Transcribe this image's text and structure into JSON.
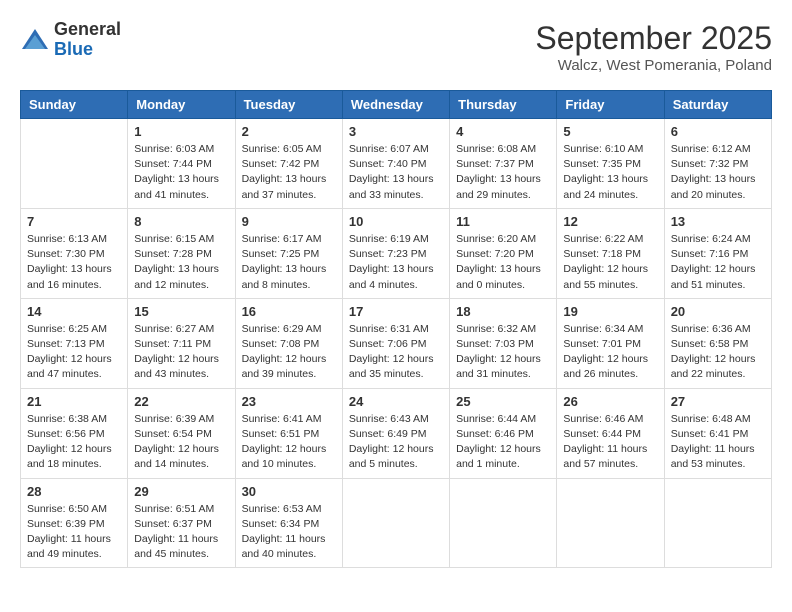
{
  "header": {
    "logo": {
      "general": "General",
      "blue": "Blue"
    },
    "title": "September 2025",
    "location": "Walcz, West Pomerania, Poland"
  },
  "weekdays": [
    "Sunday",
    "Monday",
    "Tuesday",
    "Wednesday",
    "Thursday",
    "Friday",
    "Saturday"
  ],
  "weeks": [
    [
      {
        "day": "",
        "sunrise": "",
        "sunset": "",
        "daylight": ""
      },
      {
        "day": "1",
        "sunrise": "Sunrise: 6:03 AM",
        "sunset": "Sunset: 7:44 PM",
        "daylight": "Daylight: 13 hours and 41 minutes."
      },
      {
        "day": "2",
        "sunrise": "Sunrise: 6:05 AM",
        "sunset": "Sunset: 7:42 PM",
        "daylight": "Daylight: 13 hours and 37 minutes."
      },
      {
        "day": "3",
        "sunrise": "Sunrise: 6:07 AM",
        "sunset": "Sunset: 7:40 PM",
        "daylight": "Daylight: 13 hours and 33 minutes."
      },
      {
        "day": "4",
        "sunrise": "Sunrise: 6:08 AM",
        "sunset": "Sunset: 7:37 PM",
        "daylight": "Daylight: 13 hours and 29 minutes."
      },
      {
        "day": "5",
        "sunrise": "Sunrise: 6:10 AM",
        "sunset": "Sunset: 7:35 PM",
        "daylight": "Daylight: 13 hours and 24 minutes."
      },
      {
        "day": "6",
        "sunrise": "Sunrise: 6:12 AM",
        "sunset": "Sunset: 7:32 PM",
        "daylight": "Daylight: 13 hours and 20 minutes."
      }
    ],
    [
      {
        "day": "7",
        "sunrise": "Sunrise: 6:13 AM",
        "sunset": "Sunset: 7:30 PM",
        "daylight": "Daylight: 13 hours and 16 minutes."
      },
      {
        "day": "8",
        "sunrise": "Sunrise: 6:15 AM",
        "sunset": "Sunset: 7:28 PM",
        "daylight": "Daylight: 13 hours and 12 minutes."
      },
      {
        "day": "9",
        "sunrise": "Sunrise: 6:17 AM",
        "sunset": "Sunset: 7:25 PM",
        "daylight": "Daylight: 13 hours and 8 minutes."
      },
      {
        "day": "10",
        "sunrise": "Sunrise: 6:19 AM",
        "sunset": "Sunset: 7:23 PM",
        "daylight": "Daylight: 13 hours and 4 minutes."
      },
      {
        "day": "11",
        "sunrise": "Sunrise: 6:20 AM",
        "sunset": "Sunset: 7:20 PM",
        "daylight": "Daylight: 13 hours and 0 minutes."
      },
      {
        "day": "12",
        "sunrise": "Sunrise: 6:22 AM",
        "sunset": "Sunset: 7:18 PM",
        "daylight": "Daylight: 12 hours and 55 minutes."
      },
      {
        "day": "13",
        "sunrise": "Sunrise: 6:24 AM",
        "sunset": "Sunset: 7:16 PM",
        "daylight": "Daylight: 12 hours and 51 minutes."
      }
    ],
    [
      {
        "day": "14",
        "sunrise": "Sunrise: 6:25 AM",
        "sunset": "Sunset: 7:13 PM",
        "daylight": "Daylight: 12 hours and 47 minutes."
      },
      {
        "day": "15",
        "sunrise": "Sunrise: 6:27 AM",
        "sunset": "Sunset: 7:11 PM",
        "daylight": "Daylight: 12 hours and 43 minutes."
      },
      {
        "day": "16",
        "sunrise": "Sunrise: 6:29 AM",
        "sunset": "Sunset: 7:08 PM",
        "daylight": "Daylight: 12 hours and 39 minutes."
      },
      {
        "day": "17",
        "sunrise": "Sunrise: 6:31 AM",
        "sunset": "Sunset: 7:06 PM",
        "daylight": "Daylight: 12 hours and 35 minutes."
      },
      {
        "day": "18",
        "sunrise": "Sunrise: 6:32 AM",
        "sunset": "Sunset: 7:03 PM",
        "daylight": "Daylight: 12 hours and 31 minutes."
      },
      {
        "day": "19",
        "sunrise": "Sunrise: 6:34 AM",
        "sunset": "Sunset: 7:01 PM",
        "daylight": "Daylight: 12 hours and 26 minutes."
      },
      {
        "day": "20",
        "sunrise": "Sunrise: 6:36 AM",
        "sunset": "Sunset: 6:58 PM",
        "daylight": "Daylight: 12 hours and 22 minutes."
      }
    ],
    [
      {
        "day": "21",
        "sunrise": "Sunrise: 6:38 AM",
        "sunset": "Sunset: 6:56 PM",
        "daylight": "Daylight: 12 hours and 18 minutes."
      },
      {
        "day": "22",
        "sunrise": "Sunrise: 6:39 AM",
        "sunset": "Sunset: 6:54 PM",
        "daylight": "Daylight: 12 hours and 14 minutes."
      },
      {
        "day": "23",
        "sunrise": "Sunrise: 6:41 AM",
        "sunset": "Sunset: 6:51 PM",
        "daylight": "Daylight: 12 hours and 10 minutes."
      },
      {
        "day": "24",
        "sunrise": "Sunrise: 6:43 AM",
        "sunset": "Sunset: 6:49 PM",
        "daylight": "Daylight: 12 hours and 5 minutes."
      },
      {
        "day": "25",
        "sunrise": "Sunrise: 6:44 AM",
        "sunset": "Sunset: 6:46 PM",
        "daylight": "Daylight: 12 hours and 1 minute."
      },
      {
        "day": "26",
        "sunrise": "Sunrise: 6:46 AM",
        "sunset": "Sunset: 6:44 PM",
        "daylight": "Daylight: 11 hours and 57 minutes."
      },
      {
        "day": "27",
        "sunrise": "Sunrise: 6:48 AM",
        "sunset": "Sunset: 6:41 PM",
        "daylight": "Daylight: 11 hours and 53 minutes."
      }
    ],
    [
      {
        "day": "28",
        "sunrise": "Sunrise: 6:50 AM",
        "sunset": "Sunset: 6:39 PM",
        "daylight": "Daylight: 11 hours and 49 minutes."
      },
      {
        "day": "29",
        "sunrise": "Sunrise: 6:51 AM",
        "sunset": "Sunset: 6:37 PM",
        "daylight": "Daylight: 11 hours and 45 minutes."
      },
      {
        "day": "30",
        "sunrise": "Sunrise: 6:53 AM",
        "sunset": "Sunset: 6:34 PM",
        "daylight": "Daylight: 11 hours and 40 minutes."
      },
      {
        "day": "",
        "sunrise": "",
        "sunset": "",
        "daylight": ""
      },
      {
        "day": "",
        "sunrise": "",
        "sunset": "",
        "daylight": ""
      },
      {
        "day": "",
        "sunrise": "",
        "sunset": "",
        "daylight": ""
      },
      {
        "day": "",
        "sunrise": "",
        "sunset": "",
        "daylight": ""
      }
    ]
  ]
}
